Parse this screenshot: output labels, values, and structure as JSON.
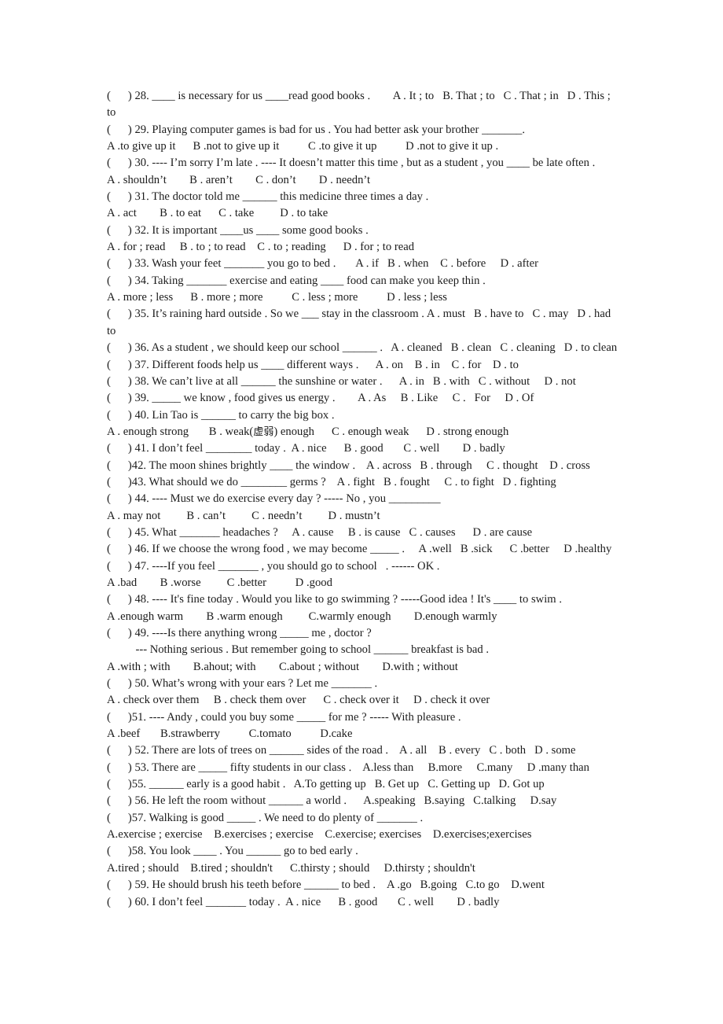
{
  "document": {
    "type": "worksheet",
    "page_background": "#ffffff",
    "text_color": "#1a1a1a",
    "lines": [
      {
        "id": "q28",
        "kind": "question",
        "text": "(      ) 28. ____ is necessary for us ____read good books .        A . It ; to   B. That ; to   C . That ; in   D . This ;"
      },
      {
        "id": "q28wrap",
        "kind": "wrap",
        "text": "to"
      },
      {
        "id": "q29",
        "kind": "question",
        "text": "(      ) 29. Playing computer games is bad for us . You had better ask your brother _______."
      },
      {
        "id": "q29opts",
        "kind": "options",
        "text": "A .to give up it      B .not to give up it          C .to give it up          D .not to give it up ."
      },
      {
        "id": "q30",
        "kind": "question",
        "text": "(      ) 30. ---- I’m sorry I’m late . ---- It doesn’t matter this time , but as a student , you ____ be late often ."
      },
      {
        "id": "q30opts",
        "kind": "options",
        "text": "A . shouldn’t        B . aren’t        C . don’t        D . needn’t"
      },
      {
        "id": "q31",
        "kind": "question",
        "text": "(      ) 31. The doctor told me ______ this medicine three times a day ."
      },
      {
        "id": "q31opts",
        "kind": "options",
        "text": "A . act        B . to eat      C . take         D . to take"
      },
      {
        "id": "q32",
        "kind": "question",
        "text": "(      ) 32. It is important ____us ____ some good books ."
      },
      {
        "id": "q32opts",
        "kind": "options",
        "text": "A . for ; read     B . to ; to read    C . to ; reading      D . for ; to read"
      },
      {
        "id": "q33",
        "kind": "question",
        "text": "(      ) 33. Wash your feet _______ you go to bed .       A . if   B . when    C . before     D . after"
      },
      {
        "id": "q34",
        "kind": "question",
        "text": "(      ) 34. Taking _______ exercise and eating ____ food can make you keep thin ."
      },
      {
        "id": "q34opts",
        "kind": "options",
        "text": "A . more ; less      B . more ; more          C . less ; more          D . less ; less"
      },
      {
        "id": "q35",
        "kind": "question",
        "text": "(      ) 35. It’s raining hard outside . So we ___ stay in the classroom . A . must   B . have to   C . may   D . had"
      },
      {
        "id": "q35wrap",
        "kind": "wrap",
        "text": "to"
      },
      {
        "id": "q36",
        "kind": "question",
        "text": "(      ) 36. As a student , we should keep our school ______ .   A . cleaned   B . clean   C . cleaning   D . to clean"
      },
      {
        "id": "q37",
        "kind": "question",
        "text": "(      ) 37. Different foods help us ____ different ways .      A . on    B . in    C . for    D . to"
      },
      {
        "id": "q38",
        "kind": "question",
        "text": "(      ) 38. We can’t live at all ______ the sunshine or water .      A . in   B . with   C . without     D . not"
      },
      {
        "id": "q39",
        "kind": "question",
        "text": "(      ) 39. _____ we know , food gives us energy .        A . As     B . Like     C .   For     D . Of"
      },
      {
        "id": "q40",
        "kind": "question",
        "text": "(      ) 40. Lin Tao is ______ to carry the big box ."
      },
      {
        "id": "q40opts",
        "kind": "options",
        "text": "A . enough strong       B . weak(虚弱) enough      C . enough weak      D . strong enough",
        "has_chinese": true
      },
      {
        "id": "q41",
        "kind": "question",
        "text": "(      ) 41. I don’t feel ________ today .  A . nice      B . good       C . well        D . badly"
      },
      {
        "id": "q42",
        "kind": "question",
        "text": "(      )42. The moon shines brightly ____ the window .    A . across   B . through     C . thought    D . cross"
      },
      {
        "id": "q43",
        "kind": "question",
        "text": "(      )43. What should we do ________ germs ?    A . fight   B . fought     C . to fight   D . fighting"
      },
      {
        "id": "q44",
        "kind": "question",
        "text": "(      ) 44. ---- Must we do exercise every day ? ----- No , you _________"
      },
      {
        "id": "q44opts",
        "kind": "options",
        "text": "A . may not         B . can’t         C . needn’t         D . mustn’t"
      },
      {
        "id": "q45",
        "kind": "question",
        "text": "(      ) 45. What _______ headaches ?     A . cause     B . is cause   C . causes      D . are cause"
      },
      {
        "id": "q46",
        "kind": "question",
        "text": "(      ) 46. If we choose the wrong food , we may become _____ .     A .well   B .sick      C .better     D .healthy"
      },
      {
        "id": "q47",
        "kind": "question",
        "text": "(      ) 47. ----If you feel _______ , you should go to school   . ------ OK ."
      },
      {
        "id": "q47opts",
        "kind": "options",
        "text": "A .bad        B .worse         C .better          D .good"
      },
      {
        "id": "q48",
        "kind": "question",
        "text": "(      ) 48. ---- It's fine today . Would you like to go swimming ? -----Good idea ! It's ____ to swim ."
      },
      {
        "id": "q48opts",
        "kind": "options",
        "text": "A .enough warm        B .warm enough         C.warmly enough        D.enough warmly"
      },
      {
        "id": "q49",
        "kind": "question",
        "text": "(      ) 49. ----Is there anything wrong _____ me , doctor ?"
      },
      {
        "id": "q49b",
        "kind": "wrap",
        "text": "          --- Nothing serious . But remember going to school ______ breakfast is bad ."
      },
      {
        "id": "q49opts",
        "kind": "options",
        "text": "A .with ; with        B.ahout; with        C.about ; without        D.with ; without"
      },
      {
        "id": "q50",
        "kind": "question",
        "text": "(      ) 50. What’s wrong with your ears ? Let me _______ ."
      },
      {
        "id": "q50opts",
        "kind": "options",
        "text": "A . check over them     B . check them over      C . check over it     D . check it over"
      },
      {
        "id": "q51",
        "kind": "question",
        "text": "(      )51. ---- Andy , could you buy some _____ for me ? ----- With pleasure ."
      },
      {
        "id": "q51opts",
        "kind": "options",
        "text": "A .beef       B.strawberry          C.tomato          D.cake"
      },
      {
        "id": "q52",
        "kind": "question",
        "text": "(      ) 52. There are lots of trees on ______ sides of the road .    A . all    B . every   C . both   D . some"
      },
      {
        "id": "q53",
        "kind": "question",
        "text": "(      ) 53. There are _____ fifty students in our class .    A.less than     B.more     C.many     D .many than"
      },
      {
        "id": "q55",
        "kind": "question",
        "text": "(      )55. ______ early is a good habit .   A.To getting up   B. Get up   C. Getting up   D. Got up"
      },
      {
        "id": "q56",
        "kind": "question",
        "text": "(      ) 56. He left the room without ______ a world .      A.speaking   B.saying   C.talking     D.say"
      },
      {
        "id": "q57",
        "kind": "question",
        "text": "(      )57. Walking is good _____ . We need to do plenty of _______ ."
      },
      {
        "id": "q57opts",
        "kind": "options",
        "text": "A.exercise ; exercise    B.exercises ; exercise    C.exercise; exercises    D.exercises;exercises"
      },
      {
        "id": "q58",
        "kind": "question",
        "text": "(      )58. You look ____ . You ______ go to bed early ."
      },
      {
        "id": "q58opts",
        "kind": "options",
        "text": "A.tired ; should    B.tired ; shouldn't      C.thirsty ; should     D.thirsty ; shouldn't"
      },
      {
        "id": "q59",
        "kind": "question",
        "text": "(      ) 59. He should brush his teeth before ______ to bed .    A .go   B.going   C.to go    D.went"
      },
      {
        "id": "q60",
        "kind": "question",
        "text": "(      ) 60. I don’t feel _______ today .  A . nice      B . good       C . well        D . badly"
      }
    ]
  }
}
